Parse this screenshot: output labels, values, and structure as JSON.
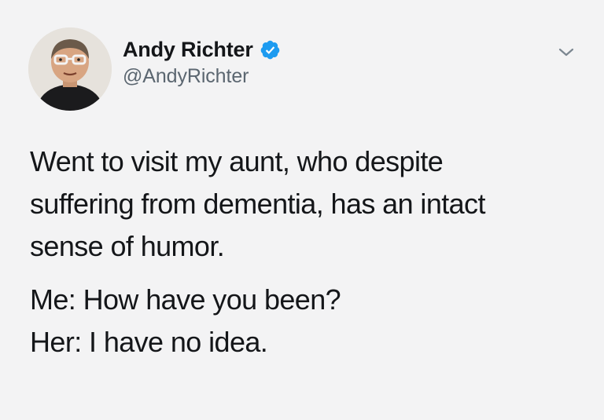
{
  "tweet": {
    "author": {
      "display_name": "Andy Richter",
      "handle": "@AndyRichter",
      "verified": true
    },
    "body": {
      "line1": "Went to visit my aunt, who despite",
      "line2": "suffering from dementia, has an intact",
      "line3": "sense of humor.",
      "line4": "Me: How have you been?",
      "line5": "Her: I have no idea."
    }
  },
  "colors": {
    "background": "#f3f3f4",
    "text": "#141619",
    "handle": "#5b6670",
    "verified_badge": "#1d9bf0"
  },
  "icons": {
    "verified": "verified-badge-icon",
    "menu": "chevron-down-icon"
  }
}
